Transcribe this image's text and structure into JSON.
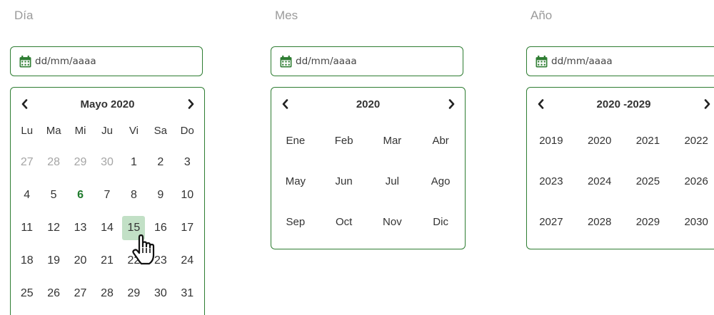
{
  "colors": {
    "accent": "#2e7d32",
    "selected_bg": "#c2e0c6",
    "muted": "#a5a5a5"
  },
  "dia": {
    "caption": "Día",
    "placeholder": "dd/mm/aaaa",
    "header": "Mayo 2020",
    "weekdays": [
      "Lu",
      "Ma",
      "Mi",
      "Ju",
      "Vi",
      "Sa",
      "Do"
    ],
    "days": [
      {
        "label": "27",
        "state": "muted"
      },
      {
        "label": "28",
        "state": "muted"
      },
      {
        "label": "29",
        "state": "muted"
      },
      {
        "label": "30",
        "state": "muted"
      },
      {
        "label": "1"
      },
      {
        "label": "2"
      },
      {
        "label": "3"
      },
      {
        "label": "4"
      },
      {
        "label": "5"
      },
      {
        "label": "6",
        "state": "today"
      },
      {
        "label": "7"
      },
      {
        "label": "8"
      },
      {
        "label": "9"
      },
      {
        "label": "10"
      },
      {
        "label": "11"
      },
      {
        "label": "12"
      },
      {
        "label": "13"
      },
      {
        "label": "14"
      },
      {
        "label": "15",
        "state": "selected"
      },
      {
        "label": "16"
      },
      {
        "label": "17"
      },
      {
        "label": "18"
      },
      {
        "label": "19"
      },
      {
        "label": "20"
      },
      {
        "label": "21"
      },
      {
        "label": "22"
      },
      {
        "label": "23"
      },
      {
        "label": "24"
      },
      {
        "label": "25"
      },
      {
        "label": "26"
      },
      {
        "label": "27"
      },
      {
        "label": "28"
      },
      {
        "label": "29"
      },
      {
        "label": "30"
      },
      {
        "label": "31"
      }
    ]
  },
  "mes": {
    "caption": "Mes",
    "placeholder": "dd/mm/aaaa",
    "header": "2020",
    "months": [
      "Ene",
      "Feb",
      "Mar",
      "Abr",
      "May",
      "Jun",
      "Jul",
      "Ago",
      "Sep",
      "Oct",
      "Nov",
      "Dic"
    ]
  },
  "ano": {
    "caption": "Año",
    "placeholder": "dd/mm/aaaa",
    "header": "2020 -2029",
    "years": [
      "2019",
      "2020",
      "2021",
      "2022",
      "2023",
      "2024",
      "2025",
      "2026",
      "2027",
      "2028",
      "2029",
      "2030"
    ]
  },
  "icons": {
    "input": "calendar-icon",
    "prev": "chevron-left-icon",
    "next": "chevron-right-icon",
    "cursor": "hand-pointer-icon"
  }
}
